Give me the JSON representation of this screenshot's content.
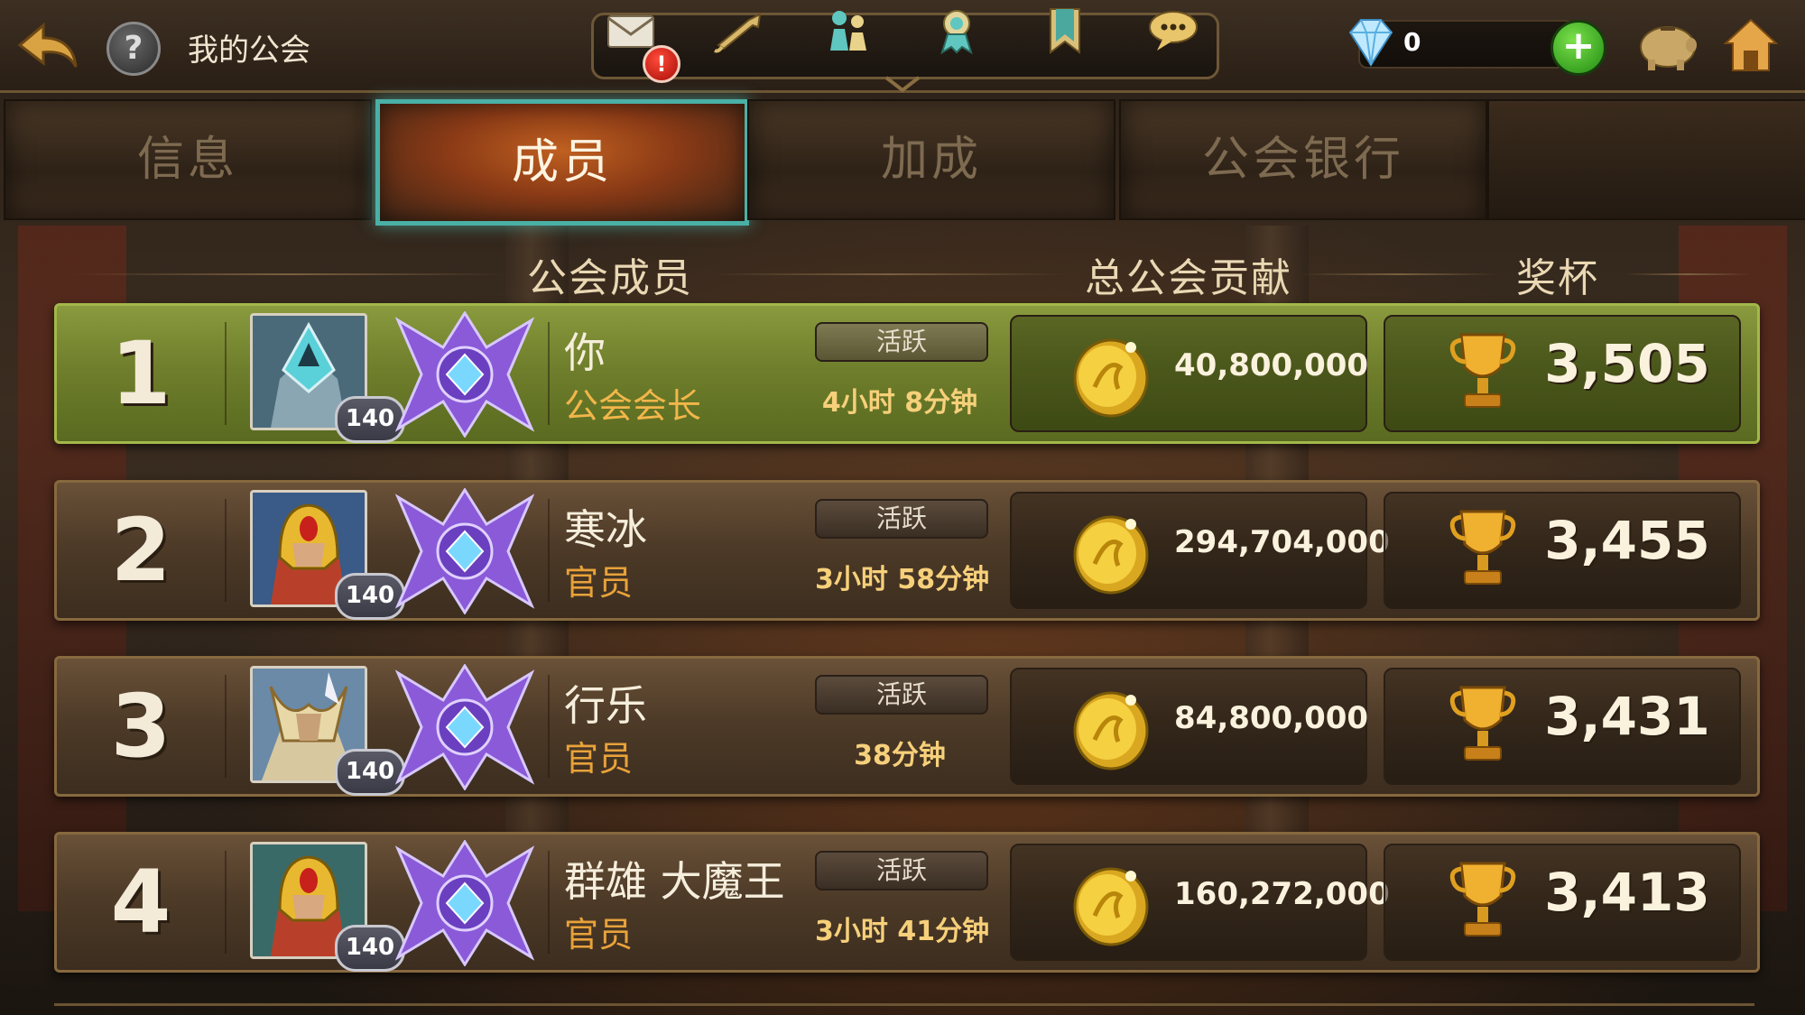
{
  "header": {
    "title": "我的公会"
  },
  "currency": {
    "gems": "0"
  },
  "notification_badge": "!",
  "tabs": [
    {
      "label": "信息",
      "active": false
    },
    {
      "label": "成员",
      "active": true
    },
    {
      "label": "加成",
      "active": false
    },
    {
      "label": "公会银行",
      "active": false
    }
  ],
  "columns": {
    "members": "公会成员",
    "contribution": "总公会贡献",
    "trophies": "奖杯"
  },
  "members": [
    {
      "rank": "1",
      "level": "140",
      "name": "你",
      "role": "公会会长",
      "status": "活跃",
      "last_seen": "4小时 8分钟",
      "contribution": "40,800,000",
      "trophies": "3,505"
    },
    {
      "rank": "2",
      "level": "140",
      "name": "寒冰",
      "role": "官员",
      "status": "活跃",
      "last_seen": "3小时 58分钟",
      "contribution": "294,704,000",
      "trophies": "3,455"
    },
    {
      "rank": "3",
      "level": "140",
      "name": "行乐",
      "role": "官员",
      "status": "活跃",
      "last_seen": "38分钟",
      "contribution": "84,800,000",
      "trophies": "3,431"
    },
    {
      "rank": "4",
      "level": "140",
      "name": "群雄 大魔王",
      "role": "官员",
      "status": "活跃",
      "last_seen": "3小时 41分钟",
      "contribution": "160,272,000",
      "trophies": "3,413"
    }
  ],
  "colors": {
    "accent_teal": "#4ab0a6",
    "highlight_green": "#7f8f34",
    "gold": "#f6d07a"
  },
  "icons": [
    "back-arrow-icon",
    "help-icon",
    "mail-icon",
    "horn-icon",
    "people-icon",
    "ribbon-icon",
    "bookmark-icon",
    "chat-icon",
    "gem-icon",
    "plus-icon",
    "piggy-bank-icon",
    "home-icon",
    "coin-icon",
    "trophy-icon",
    "rank-badge-icon"
  ]
}
